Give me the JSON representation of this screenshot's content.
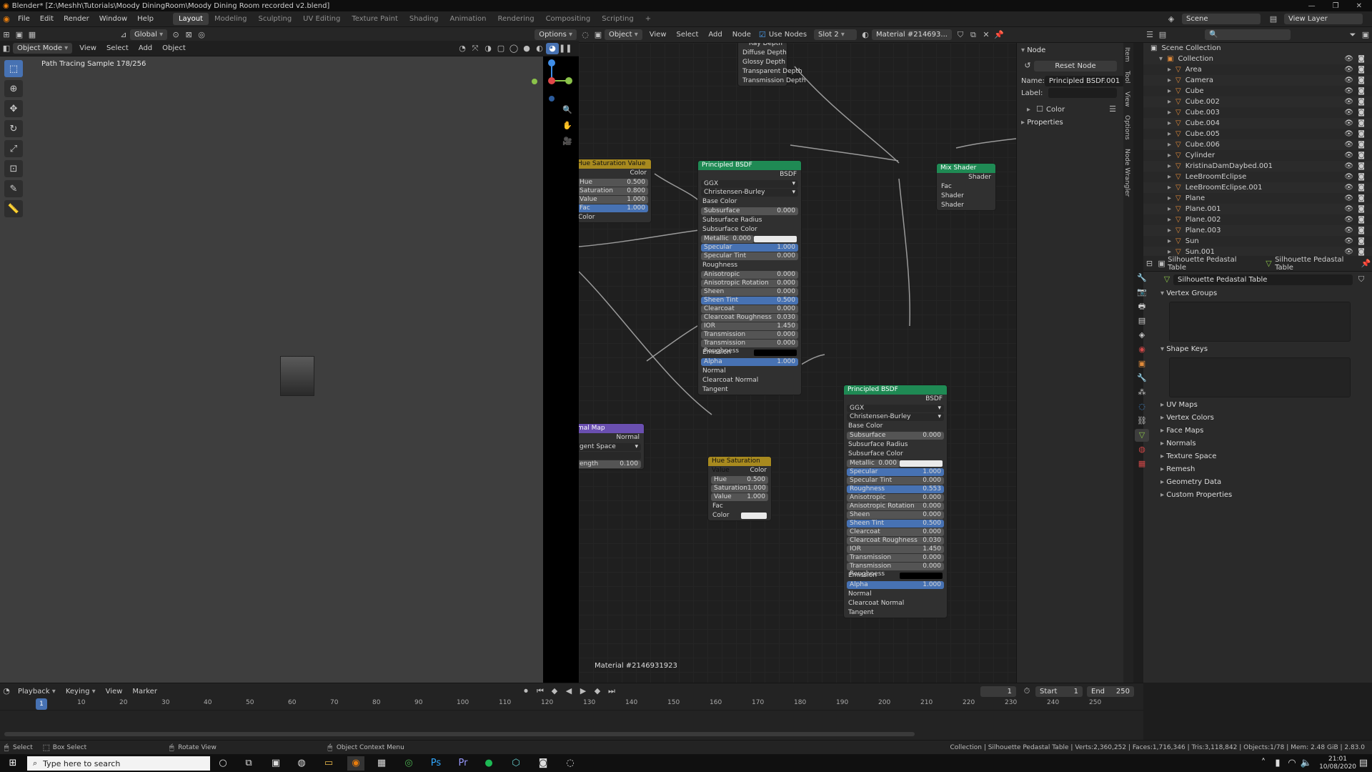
{
  "titlebar": {
    "title": "Blender* [Z:\\Meshh\\Tutorials\\Moody DiningRoom\\Moody Dining Room recorded v2.blend]",
    "min": "—",
    "max": "❐",
    "close": "✕"
  },
  "menu": [
    "File",
    "Edit",
    "Render",
    "Window",
    "Help"
  ],
  "workspaces": [
    "Layout",
    "Modeling",
    "Sculpting",
    "UV Editing",
    "Texture Paint",
    "Shading",
    "Animation",
    "Rendering",
    "Compositing",
    "Scripting",
    "+"
  ],
  "scene": "Scene",
  "view_layer": "View Layer",
  "viewport": {
    "mode": "Object Mode",
    "menus": [
      "View",
      "Select",
      "Add",
      "Object"
    ],
    "transform": "Global",
    "options": "Options",
    "status": "Path Tracing Sample 178/256"
  },
  "node_editor": {
    "object": "Object",
    "menus": [
      "View",
      "Select",
      "Add",
      "Node"
    ],
    "use_nodes": "Use Nodes",
    "slot": "Slot 2",
    "material": "Material #214693...",
    "label": "Material #2146931923"
  },
  "nodes": {
    "light_path": [
      "Ray Depth",
      "Diffuse Depth",
      "Glossy Depth",
      "Transparent Depth",
      "Transmission Depth"
    ],
    "hsv1": {
      "title": "Hue Saturation Value",
      "out": "Color",
      "hue": [
        "Hue",
        "0.500"
      ],
      "sat": [
        "Saturation",
        "0.800"
      ],
      "val": [
        "Value",
        "1.000"
      ],
      "fac": [
        "Fac",
        "1.000"
      ],
      "color": "Color"
    },
    "hsv2": {
      "title": "Hue Saturation Value",
      "out": "Color",
      "hue": [
        "Hue",
        "0.500"
      ],
      "sat": [
        "Saturation",
        "1.000"
      ],
      "val": [
        "Value",
        "1.000"
      ],
      "fac": "Fac",
      "color": "Color"
    },
    "normal_map": {
      "title": "mal Map",
      "out": "Normal",
      "space": "gent Space",
      "strength": [
        "ength",
        "0.100"
      ]
    },
    "mix": {
      "title": "Mix Shader",
      "out": "Shader",
      "fac": "Fac",
      "s1": "Shader",
      "s2": "Shader"
    },
    "bsdf1": {
      "title": "Principled BSDF",
      "out": "BSDF",
      "dist": "GGX",
      "sss": "Christensen-Burley",
      "base": "Base Color",
      "rows": [
        [
          "Subsurface",
          "0.000",
          false
        ],
        [
          "Subsurface Radius",
          "",
          false
        ],
        [
          "Subsurface Color",
          "",
          false
        ],
        [
          "Metallic",
          "0.000",
          false
        ],
        [
          "Specular",
          "1.000",
          true
        ],
        [
          "Specular Tint",
          "0.000",
          false
        ],
        [
          "Roughness",
          "",
          false
        ],
        [
          "Anisotropic",
          "0.000",
          false
        ],
        [
          "Anisotropic Rotation",
          "0.000",
          false
        ],
        [
          "Sheen",
          "0.000",
          false
        ],
        [
          "Sheen Tint",
          "0.500",
          true
        ],
        [
          "Clearcoat",
          "0.000",
          false
        ],
        [
          "Clearcoat Roughness",
          "0.030",
          false
        ],
        [
          "IOR",
          "1.450",
          false
        ],
        [
          "Transmission",
          "0.000",
          false
        ],
        [
          "Transmission Roughness",
          "0.000",
          false
        ],
        [
          "Emission",
          "",
          false
        ],
        [
          "Alpha",
          "1.000",
          true
        ]
      ],
      "tail": [
        "Normal",
        "Clearcoat Normal",
        "Tangent"
      ]
    },
    "bsdf2": {
      "title": "Principled BSDF",
      "out": "BSDF",
      "dist": "GGX",
      "sss": "Christensen-Burley",
      "base": "Base Color",
      "rows": [
        [
          "Subsurface",
          "0.000",
          false
        ],
        [
          "Subsurface Radius",
          "",
          false
        ],
        [
          "Subsurface Color",
          "",
          false
        ],
        [
          "Metallic",
          "0.000",
          false
        ],
        [
          "Specular",
          "1.000",
          true
        ],
        [
          "Specular Tint",
          "0.000",
          false
        ],
        [
          "Roughness",
          "0.553",
          true
        ],
        [
          "Anisotropic",
          "0.000",
          false
        ],
        [
          "Anisotropic Rotation",
          "0.000",
          false
        ],
        [
          "Sheen",
          "0.000",
          false
        ],
        [
          "Sheen Tint",
          "0.500",
          true
        ],
        [
          "Clearcoat",
          "0.000",
          false
        ],
        [
          "Clearcoat Roughness",
          "0.030",
          false
        ],
        [
          "IOR",
          "1.450",
          false
        ],
        [
          "Transmission",
          "0.000",
          false
        ],
        [
          "Transmission Roughness",
          "0.000",
          false
        ],
        [
          "Emission",
          "",
          false
        ],
        [
          "Alpha",
          "1.000",
          true
        ]
      ],
      "tail": [
        "Normal",
        "Clearcoat Normal",
        "Tangent"
      ]
    }
  },
  "npanel": {
    "header": "Node",
    "reset": "Reset Node",
    "name_label": "Name:",
    "name": "Principled BSDF.001",
    "label_label": "Label:",
    "color": "Color",
    "properties": "Properties",
    "tabs": [
      "Item",
      "Tool",
      "View",
      "Options",
      "Node Wrangler"
    ]
  },
  "outliner": {
    "root": "Scene Collection",
    "items": [
      "Collection",
      "Area",
      "Camera",
      "Cube",
      "Cube.002",
      "Cube.003",
      "Cube.004",
      "Cube.005",
      "Cube.006",
      "Cylinder",
      "KristinaDamDaybed.001",
      "LeeBroomEclipse",
      "LeeBroomEclipse.001",
      "Plane",
      "Plane.001",
      "Plane.002",
      "Plane.003",
      "Sun",
      "Sun.001"
    ]
  },
  "props": {
    "object": "Silhouette Pedastal Table",
    "mesh": "Silhouette Pedastal Table",
    "data": "Silhouette Pedastal Table",
    "sections": [
      "Vertex Groups",
      "Shape Keys",
      "UV Maps",
      "Vertex Colors",
      "Face Maps",
      "Normals",
      "Texture Space",
      "Remesh",
      "Geometry Data",
      "Custom Properties"
    ]
  },
  "timeline": {
    "menus": [
      "Playback",
      "Keying",
      "View",
      "Marker"
    ],
    "frame": "1",
    "start_label": "Start",
    "start": "1",
    "end_label": "End",
    "end": "250",
    "ticks": [
      "10",
      "20",
      "30",
      "40",
      "50",
      "60",
      "70",
      "80",
      "90",
      "100",
      "110",
      "120",
      "130",
      "140",
      "150",
      "160",
      "170",
      "180",
      "190",
      "200",
      "210",
      "220",
      "230",
      "240",
      "250"
    ]
  },
  "status": {
    "select": "Select",
    "box": "Box Select",
    "rotate": "Rotate View",
    "context": "Object Context Menu",
    "info": "Collection | Silhouette Pedastal Table | Verts:2,360,252 | Faces:1,716,346 | Tris:3,118,842 | Objects:1/78 | Mem: 2.48 GiB | 2.83.0"
  },
  "taskbar": {
    "search": "Type here to search",
    "time": "21:01",
    "date": "10/08/2020"
  }
}
